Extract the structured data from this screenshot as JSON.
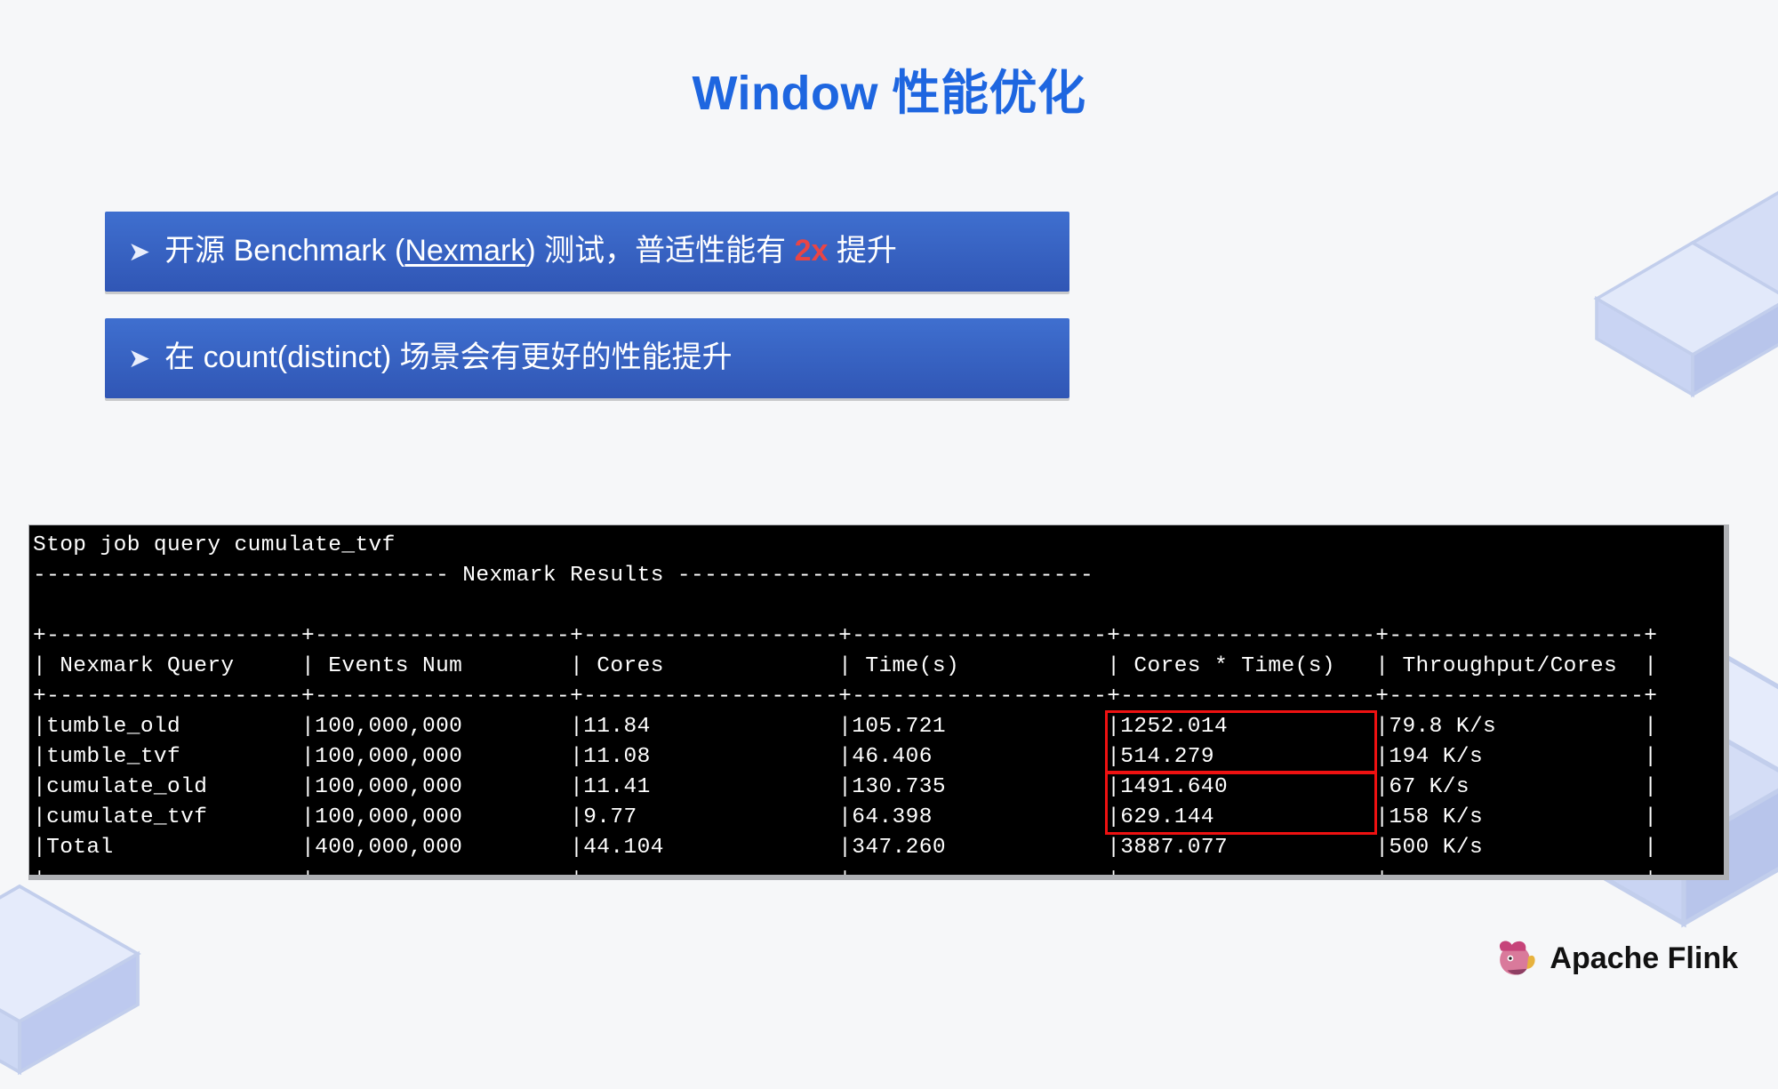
{
  "title": "Window 性能优化",
  "bullets": {
    "b1_pre": "开源 Benchmark (",
    "b1_link": "Nexmark",
    "b1_mid": ") 测试，普适性能有 ",
    "b1_hl": "2x",
    "b1_post": " 提升",
    "b2": "在 count(distinct) 场景会有更好的性能提升"
  },
  "terminal": {
    "stop_line": "Stop job query cumulate_tvf",
    "results_rule_left": "------------------------------- ",
    "results_title": "Nexmark Results",
    "results_rule_right": " -------------------------------",
    "sep": "+-------------------+-------------------+-------------------+-------------------+-------------------+-------------------+",
    "header": "| Nexmark Query     | Events Num        | Cores             | Time(s)           | Cores * Time(s)   | Throughput/Cores  |",
    "rows": [
      "|tumble_old         |100,000,000        |11.84              |105.721            |1252.014           |79.8 K/s           |",
      "|tumble_tvf         |100,000,000        |11.08              |46.406             |514.279            |194 K/s            |",
      "|cumulate_old       |100,000,000        |11.41              |130.735            |1491.640           |67 K/s             |",
      "|cumulate_tvf       |100,000,000        |9.77               |64.398             |629.144            |158 K/s            |",
      "|Total              |400,000,000        |44.104             |347.260            |3887.077           |500 K/s            |"
    ]
  },
  "chart_data": {
    "type": "table",
    "title": "Nexmark Results",
    "columns": [
      "Nexmark Query",
      "Events Num",
      "Cores",
      "Time(s)",
      "Cores * Time(s)",
      "Throughput/Cores"
    ],
    "rows": [
      {
        "query": "tumble_old",
        "events": 100000000,
        "cores": 11.84,
        "time_s": 105.721,
        "cores_x_time": 1252.014,
        "throughput_per_core": "79.8 K/s"
      },
      {
        "query": "tumble_tvf",
        "events": 100000000,
        "cores": 11.08,
        "time_s": 46.406,
        "cores_x_time": 514.279,
        "throughput_per_core": "194 K/s"
      },
      {
        "query": "cumulate_old",
        "events": 100000000,
        "cores": 11.41,
        "time_s": 130.735,
        "cores_x_time": 1491.64,
        "throughput_per_core": "67 K/s"
      },
      {
        "query": "cumulate_tvf",
        "events": 100000000,
        "cores": 9.77,
        "time_s": 64.398,
        "cores_x_time": 629.144,
        "throughput_per_core": "158 K/s"
      },
      {
        "query": "Total",
        "events": 400000000,
        "cores": 44.104,
        "time_s": 347.26,
        "cores_x_time": 3887.077,
        "throughput_per_core": "500 K/s"
      }
    ],
    "highlighted_column": "Cores * Time(s)",
    "highlighted_rows": [
      [
        "tumble_old",
        "tumble_tvf"
      ],
      [
        "cumulate_old",
        "cumulate_tvf"
      ]
    ]
  },
  "footer": {
    "brand": "Apache Flink"
  }
}
